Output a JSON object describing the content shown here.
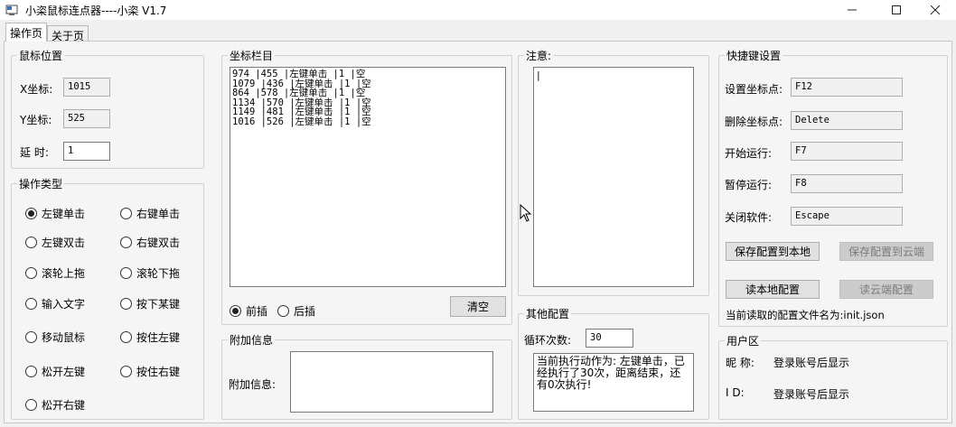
{
  "window": {
    "title": "小栥鼠标连点器----小栥 V1.7"
  },
  "tabs": [
    {
      "label": "操作页"
    },
    {
      "label": "关于页"
    }
  ],
  "mouse_pos": {
    "title": "鼠标位置",
    "x_label": "X坐标:",
    "x_value": "1015",
    "y_label": "Y坐标:",
    "y_value": "525",
    "delay_label": "延 时:",
    "delay_value": "1"
  },
  "op_type": {
    "title": "操作类型",
    "options": [
      "左键单击",
      "右键单击",
      "左键双击",
      "右键双击",
      "滚轮上拖",
      "滚轮下拖",
      "输入文字",
      "按下某键",
      "移动鼠标",
      "按住左键",
      "松开左键",
      "按住右键",
      "松开右键"
    ],
    "selected": "左键单击"
  },
  "coords": {
    "title": "坐标栏目",
    "rows": [
      "974 |455 |左键单击 |1 |空",
      "1079 |436 |左键单击 |1 |空",
      "864 |578 |左键单击 |1 |空",
      "1134 |570 |左键单击 |1 |空",
      "1149 |481 |左键单击 |1 |空",
      "1016 |526 |左键单击 |1 |空"
    ],
    "insert_before": "前插",
    "insert_after": "后插",
    "clear_label": "清空"
  },
  "extra": {
    "title": "附加信息",
    "label": "附加信息:",
    "value": ""
  },
  "notice": {
    "title": "注意:",
    "value": "|"
  },
  "other": {
    "title": "其他配置",
    "loop_label": "循环次数:",
    "loop_value": "30",
    "status": "当前执行动作为: 左键单击，已经执行了30次，距离结束，还有0次执行!"
  },
  "hotkeys": {
    "title": "快捷键设置",
    "set_label": "设置坐标点:",
    "set_value": "F12",
    "del_label": "删除坐标点:",
    "del_value": "Delete",
    "start_label": "开始运行:",
    "start_value": "F7",
    "pause_label": "暂停运行:",
    "pause_value": "F8",
    "close_label": "关闭软件:",
    "close_value": "Escape",
    "save_local": "保存配置到本地",
    "save_cloud": "保存配置到云端",
    "load_local": "读本地配置",
    "load_cloud": "读云端配置",
    "config_file": "当前读取的配置文件名为:init.json"
  },
  "user": {
    "title": "用户区",
    "nick_label": "昵 称:",
    "nick_value": "登录账号后显示",
    "id_label": "I D:",
    "id_value": "登录账号后显示"
  }
}
